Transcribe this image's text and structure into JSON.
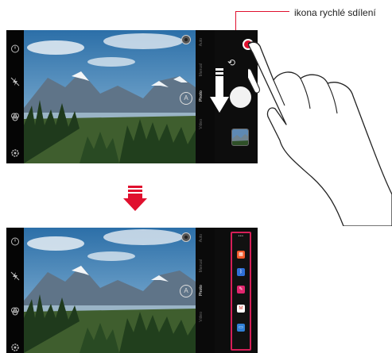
{
  "callout": {
    "label": "ikona rychlé sdílení"
  },
  "top_screen": {
    "modes": [
      "Auto",
      "Manual",
      "Photo",
      "Video"
    ],
    "active_mode": "Photo",
    "focus_label": "A"
  },
  "bottom_screen": {
    "modes": [
      "Auto",
      "Manual",
      "Photo",
      "Video"
    ],
    "active_mode": "Photo",
    "focus_label": "A",
    "share_dots": "•••",
    "share_apps": [
      {
        "name": "gallery-app-icon",
        "color": "#f05a2a",
        "glyph": "▦"
      },
      {
        "name": "bluetooth-icon",
        "color": "#2f6fd6",
        "glyph": "ᛒ"
      },
      {
        "name": "pen-app-icon",
        "color": "#e2266e",
        "glyph": "✎"
      },
      {
        "name": "gmail-icon",
        "color": "#ffffff",
        "glyph": "M"
      },
      {
        "name": "message-icon",
        "color": "#2f7fd6",
        "glyph": "▭"
      }
    ]
  },
  "colors": {
    "accent": "#e0102e",
    "panel_border": "#d61f58",
    "arrow": "#e0102e"
  }
}
